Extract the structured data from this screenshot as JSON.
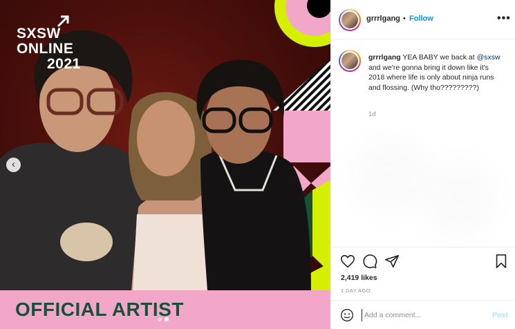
{
  "post": {
    "photo": {
      "festival_lines": [
        "SXSW",
        "ONLINE",
        "2021"
      ],
      "banner": "OFFICIAL ARTIST",
      "carousel_prev": "‹",
      "slides_count": 2,
      "active_slide": 2
    },
    "header": {
      "username": "grrrlgang",
      "separator": "•",
      "follow_label": "Follow",
      "more_icon": "more-horizontal-icon",
      "more_label": "•••"
    },
    "caption": {
      "username": "grrrlgang",
      "text_before": "YEA BABY we back at",
      "mention": "@sxsw",
      "text_after": "and we're gonna bring it down like it's 2018 where life is only about ninja runs and flossing. (Why tho?????????)",
      "time": "1d"
    },
    "actions": {
      "icons": [
        "heart-icon",
        "comment-icon",
        "share-icon",
        "bookmark-icon"
      ],
      "likes": "2,419 likes",
      "posted_ago": "1 DAY AGO"
    },
    "comment": {
      "emoji_icon": "smiley-icon",
      "placeholder": "Add a comment...",
      "post_label": "Post"
    },
    "colors": {
      "follow": "#0095f6",
      "banner_bg": "#f2a7c9",
      "banner_text": "#16523a",
      "lime": "#d4f000",
      "pink": "#f2a7c9",
      "green": "#16523a"
    }
  }
}
